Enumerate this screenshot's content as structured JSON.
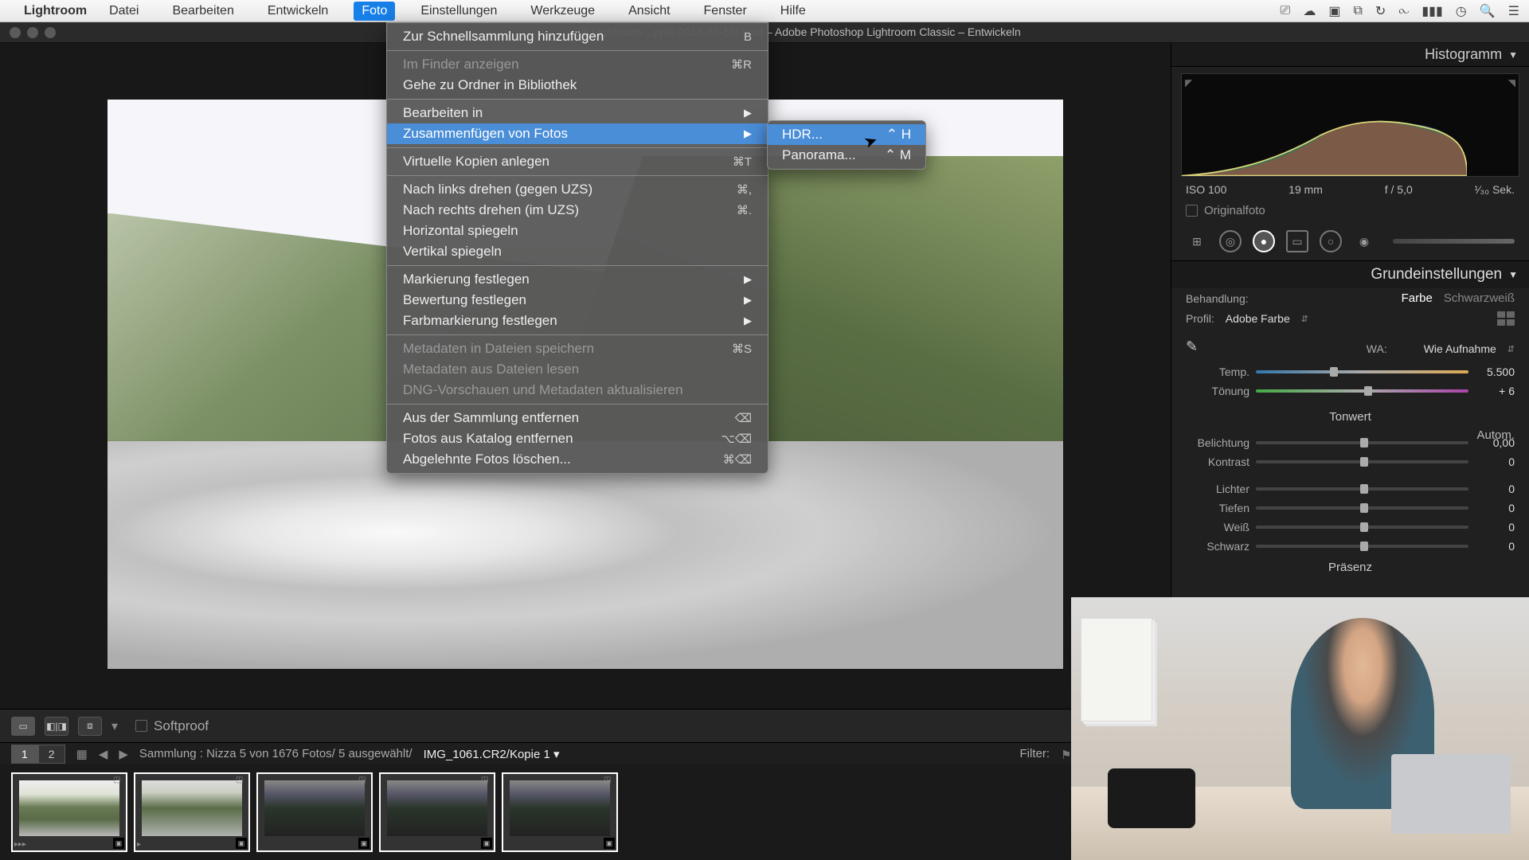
{
  "menubar": {
    "app": "Lightroom",
    "items": [
      "Datei",
      "Bearbeiten",
      "Entwickeln",
      "Foto",
      "Einstellungen",
      "Werkzeuge",
      "Ansicht",
      "Fenster",
      "Hilfe"
    ],
    "active_index": 3
  },
  "window_title": "Lightroom  ...ppie 2018-06-18).lrcat – Adobe Photoshop Lightroom Classic – Entwickeln",
  "foto_menu": [
    {
      "label": "Zur Schnellsammlung hinzufügen",
      "sc": "B"
    },
    {
      "sep": true
    },
    {
      "label": "Im Finder anzeigen",
      "sc": "⌘R",
      "dis": true
    },
    {
      "label": "Gehe zu Ordner in Bibliothek"
    },
    {
      "sep": true
    },
    {
      "label": "Bearbeiten in",
      "sub": true
    },
    {
      "label": "Zusammenfügen von Fotos",
      "sub": true,
      "hl": true
    },
    {
      "sep": true
    },
    {
      "label": "Virtuelle Kopien anlegen",
      "sc": "⌘T"
    },
    {
      "sep": true
    },
    {
      "label": "Nach links drehen (gegen UZS)",
      "sc": "⌘,"
    },
    {
      "label": "Nach rechts drehen (im UZS)",
      "sc": "⌘."
    },
    {
      "label": "Horizontal spiegeln"
    },
    {
      "label": "Vertikal spiegeln"
    },
    {
      "sep": true
    },
    {
      "label": "Markierung festlegen",
      "sub": true
    },
    {
      "label": "Bewertung festlegen",
      "sub": true
    },
    {
      "label": "Farbmarkierung festlegen",
      "sub": true
    },
    {
      "sep": true
    },
    {
      "label": "Metadaten in Dateien speichern",
      "sc": "⌘S",
      "dis": true
    },
    {
      "label": "Metadaten aus Dateien lesen",
      "dis": true
    },
    {
      "label": "DNG-Vorschauen und Metadaten aktualisieren",
      "dis": true
    },
    {
      "sep": true
    },
    {
      "label": "Aus der Sammlung entfernen",
      "sc": "⌫"
    },
    {
      "label": "Fotos aus Katalog entfernen",
      "sc": "⌥⌫"
    },
    {
      "label": "Abgelehnte Fotos löschen...",
      "sc": "⌘⌫"
    }
  ],
  "submenu": [
    {
      "label": "HDR...",
      "sc": "⌃ H",
      "hl": true
    },
    {
      "label": "Panorama...",
      "sc": "⌃ M"
    }
  ],
  "softproof_label": "Softproof",
  "filminfo": {
    "pages": [
      "1",
      "2"
    ],
    "active_page": 0,
    "text": "Sammlung : Nizza   5 von 1676 Fotos/  5 ausgewählt/",
    "filename": "IMG_1061.CR2/Kopie 1",
    "filter_label": "Filter:"
  },
  "right": {
    "histogram_title": "Histogramm",
    "exif": {
      "iso": "ISO 100",
      "focal": "19 mm",
      "ap": "f / 5,0",
      "sh": "¹⁄₃₀ Sek."
    },
    "originalfoto": "Originalfoto",
    "basic_title": "Grundeinstellungen",
    "treatment_label": "Behandlung:",
    "color": "Farbe",
    "bw": "Schwarzweiß",
    "profile_label": "Profil:",
    "profile_value": "Adobe Farbe",
    "wb_label": "WA:",
    "wb_value": "Wie Aufnahme",
    "temp_label": "Temp.",
    "temp_value": "5.500",
    "tint_label": "Tönung",
    "tint_value": "+ 6",
    "tone_title": "Tonwert",
    "auto": "Autom.",
    "sliders": [
      {
        "lab": "Belichtung",
        "val": "0,00"
      },
      {
        "lab": "Kontrast",
        "val": "0"
      },
      {
        "lab": "Lichter",
        "val": "0"
      },
      {
        "lab": "Tiefen",
        "val": "0"
      },
      {
        "lab": "Weiß",
        "val": "0"
      },
      {
        "lab": "Schwarz",
        "val": "0"
      }
    ],
    "presence_title": "Präsenz"
  }
}
